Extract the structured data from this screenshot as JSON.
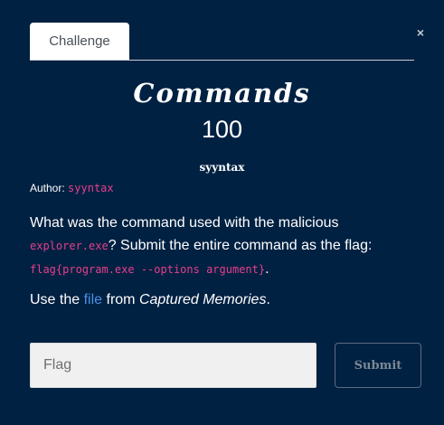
{
  "tab": {
    "label": "Challenge"
  },
  "close_icon": "×",
  "challenge": {
    "name": "Commands",
    "points": "100",
    "author_display": "syyntax",
    "author_label": "Author:",
    "author_handle": "syyntax"
  },
  "description": {
    "part1": "What was the command used with the malicious ",
    "code1": "explorer.exe",
    "part2": "? Submit the entire command as the flag: ",
    "code2": "flag{program.exe --options argument}",
    "part3": "."
  },
  "use_line": {
    "part1": "Use the ",
    "link": "file",
    "part2": " from ",
    "italic": "Captured Memories",
    "part3": "."
  },
  "form": {
    "placeholder": "Flag",
    "submit_label": "Submit"
  }
}
